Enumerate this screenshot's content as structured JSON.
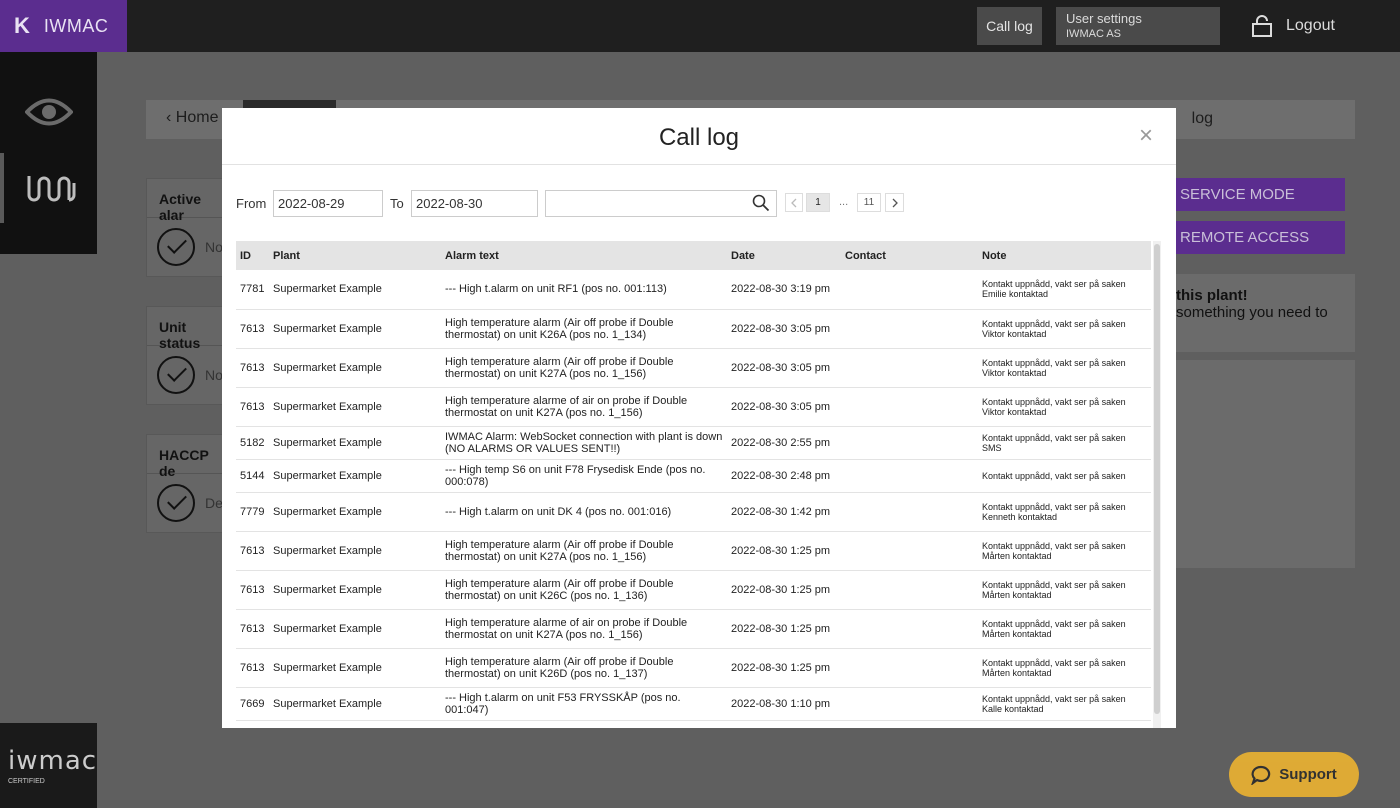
{
  "topbar": {
    "brand_mark": "K",
    "brand_name": "IWMAC",
    "call_log": "Call log",
    "user_settings": "User settings",
    "company": "IWMAC AS",
    "logout": "Logout"
  },
  "sidebar": {
    "items": [
      {
        "icon": "eye-icon"
      },
      {
        "icon": "wm-icon"
      }
    ],
    "logo_text": "iwmac",
    "logo_sub": "CERTIFIED"
  },
  "background": {
    "home": "Home",
    "breadcrumb_tail": "log",
    "cards": [
      {
        "title": "Active alar",
        "text": "No"
      },
      {
        "title": "Unit status",
        "text": "No"
      },
      {
        "title": "HACCP de",
        "text": "Dev"
      }
    ],
    "service_mode": "SERVICE MODE",
    "remote_access": "REMOTE ACCESS",
    "panel_title": "this plant!",
    "panel_text": "something you need to"
  },
  "modal": {
    "title": "Call log",
    "close": "×",
    "from_label": "From",
    "from_value": "2022-08-29",
    "to_label": "To",
    "to_value": "2022-08-30",
    "search_value": "",
    "pagination": {
      "current": "1",
      "ellipsis": "...",
      "last": "11"
    },
    "columns": {
      "id": "ID",
      "plant": "Plant",
      "alarm_text": "Alarm text",
      "date": "Date",
      "contact": "Contact",
      "note": "Note"
    },
    "rows": [
      {
        "id": "7781",
        "plant": "Supermarket Example",
        "alarm": "--- High t.alarm on unit RF1 (pos no. 001:113)",
        "date": "2022-08-30 3:19 pm",
        "contact": "",
        "note1": "Kontakt uppnådd, vakt ser på saken",
        "note2": "Emilie kontaktad"
      },
      {
        "id": "7613",
        "plant": "Supermarket Example",
        "alarm": "High temperature alarm (Air off probe if Double thermostat) on unit K26A (pos no. 1_134)",
        "date": "2022-08-30 3:05 pm",
        "contact": "",
        "note1": "Kontakt uppnådd, vakt ser på saken",
        "note2": "Viktor kontaktad"
      },
      {
        "id": "7613",
        "plant": "Supermarket Example",
        "alarm": "High temperature alarm (Air off probe if Double thermostat) on unit K27A (pos no. 1_156)",
        "date": "2022-08-30 3:05 pm",
        "contact": "",
        "note1": "Kontakt uppnådd, vakt ser på saken",
        "note2": "Viktor kontaktad"
      },
      {
        "id": "7613",
        "plant": "Supermarket Example",
        "alarm": "High temperature alarme of air on probe if Double thermostat on unit K27A (pos no. 1_156)",
        "date": "2022-08-30 3:05 pm",
        "contact": "",
        "note1": "Kontakt uppnådd, vakt ser på saken",
        "note2": "Viktor kontaktad"
      },
      {
        "id": "5182",
        "plant": "Supermarket Example",
        "alarm": "IWMAC Alarm: WebSocket connection with plant is down (NO ALARMS OR VALUES SENT!!)",
        "date": "2022-08-30 2:55 pm",
        "contact": "",
        "note1": "Kontakt uppnådd, vakt ser på saken",
        "note2": "SMS"
      },
      {
        "id": "5144",
        "plant": "Supermarket Example",
        "alarm": "--- High temp S6 on unit F78 Frysedisk Ende (pos no. 000:078)",
        "date": "2022-08-30 2:48 pm",
        "contact": "",
        "note1": "Kontakt uppnådd, vakt ser på saken",
        "note2": ""
      },
      {
        "id": "7779",
        "plant": "Supermarket Example",
        "alarm": "--- High t.alarm on unit DK 4 (pos no. 001:016)",
        "date": "2022-08-30 1:42 pm",
        "contact": "",
        "note1": "Kontakt uppnådd, vakt ser på saken",
        "note2": "Kenneth kontaktad"
      },
      {
        "id": "7613",
        "plant": "Supermarket Example",
        "alarm": "High temperature alarm (Air off probe if Double thermostat) on unit K27A (pos no. 1_156)",
        "date": "2022-08-30 1:25 pm",
        "contact": "",
        "note1": "Kontakt uppnådd, vakt ser på saken",
        "note2": "Mårten kontaktad"
      },
      {
        "id": "7613",
        "plant": "Supermarket Example",
        "alarm": "High temperature alarm (Air off probe if Double thermostat) on unit K26C (pos no. 1_136)",
        "date": "2022-08-30 1:25 pm",
        "contact": "",
        "note1": "Kontakt uppnådd, vakt ser på saken",
        "note2": "Mårten kontaktad"
      },
      {
        "id": "7613",
        "plant": "Supermarket Example",
        "alarm": "High temperature alarme of air on probe if Double thermostat on unit K27A (pos no. 1_156)",
        "date": "2022-08-30 1:25 pm",
        "contact": "",
        "note1": "Kontakt uppnådd, vakt ser på saken",
        "note2": "Mårten kontaktad"
      },
      {
        "id": "7613",
        "plant": "Supermarket Example",
        "alarm": "High temperature alarm (Air off probe if Double thermostat) on unit K26D (pos no. 1_137)",
        "date": "2022-08-30 1:25 pm",
        "contact": "",
        "note1": "Kontakt uppnådd, vakt ser på saken",
        "note2": "Mårten kontaktad"
      },
      {
        "id": "7669",
        "plant": "Supermarket Example",
        "alarm": "--- High t.alarm on unit F53 FRYSSKÅP (pos no. 001:047)",
        "date": "2022-08-30 1:10 pm",
        "contact": "",
        "note1": "Kontakt uppnådd, vakt ser på saken",
        "note2": "Kalle kontaktad"
      }
    ]
  },
  "support": {
    "label": "Support"
  }
}
